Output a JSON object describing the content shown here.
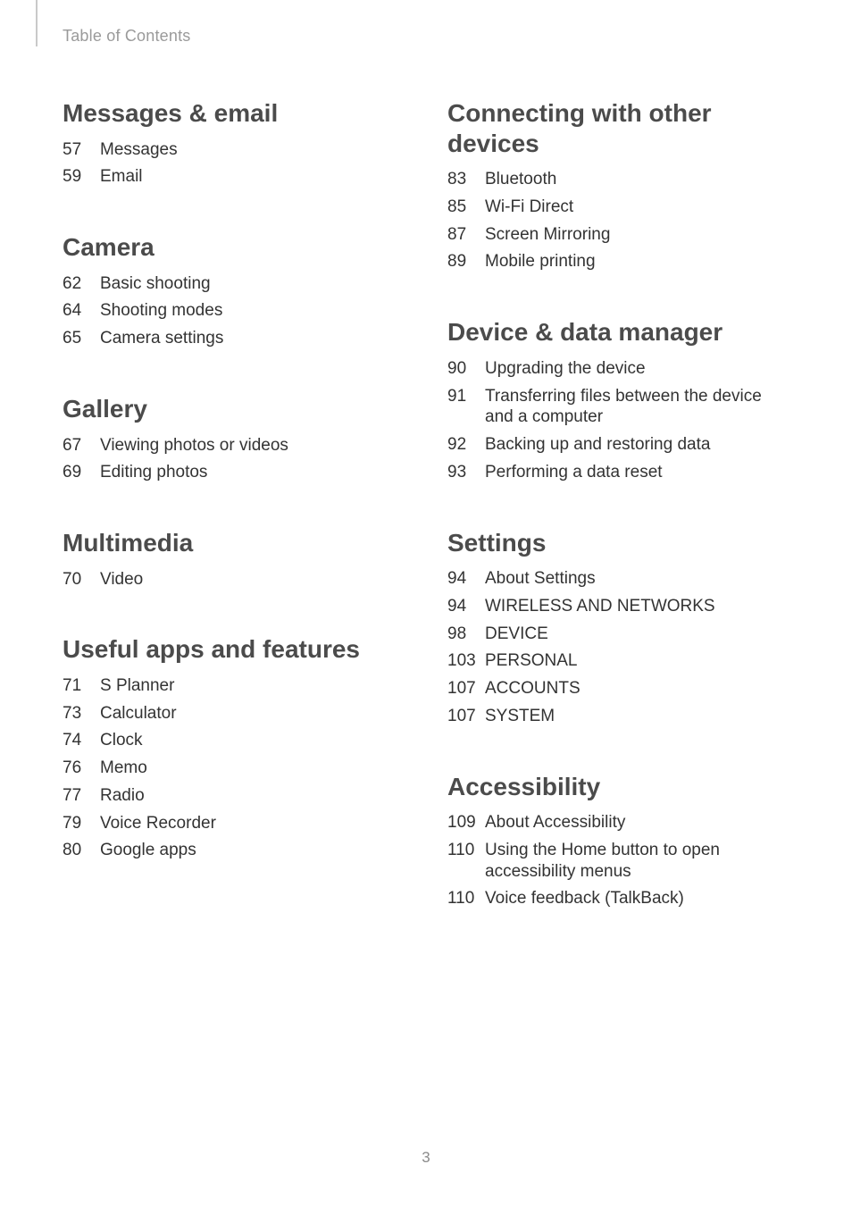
{
  "running_head": "Table of Contents",
  "page_number": "3",
  "left_sections": [
    {
      "title": "Messages & email",
      "entries": [
        {
          "page": "57",
          "title": "Messages"
        },
        {
          "page": "59",
          "title": "Email"
        }
      ]
    },
    {
      "title": "Camera",
      "entries": [
        {
          "page": "62",
          "title": "Basic shooting"
        },
        {
          "page": "64",
          "title": "Shooting modes"
        },
        {
          "page": "65",
          "title": "Camera settings"
        }
      ]
    },
    {
      "title": "Gallery",
      "entries": [
        {
          "page": "67",
          "title": "Viewing photos or videos"
        },
        {
          "page": "69",
          "title": "Editing photos"
        }
      ]
    },
    {
      "title": "Multimedia",
      "entries": [
        {
          "page": "70",
          "title": "Video"
        }
      ]
    },
    {
      "title": "Useful apps and features",
      "entries": [
        {
          "page": "71",
          "title": "S Planner"
        },
        {
          "page": "73",
          "title": "Calculator"
        },
        {
          "page": "74",
          "title": "Clock"
        },
        {
          "page": "76",
          "title": "Memo"
        },
        {
          "page": "77",
          "title": "Radio"
        },
        {
          "page": "79",
          "title": "Voice Recorder"
        },
        {
          "page": "80",
          "title": "Google apps"
        }
      ]
    }
  ],
  "right_sections": [
    {
      "title": "Connecting with other devices",
      "entries": [
        {
          "page": "83",
          "title": "Bluetooth"
        },
        {
          "page": "85",
          "title": "Wi-Fi Direct"
        },
        {
          "page": "87",
          "title": "Screen Mirroring"
        },
        {
          "page": "89",
          "title": "Mobile printing"
        }
      ]
    },
    {
      "title": "Device & data manager",
      "entries": [
        {
          "page": "90",
          "title": "Upgrading the device"
        },
        {
          "page": "91",
          "title": "Transferring files between the device and a computer"
        },
        {
          "page": "92",
          "title": "Backing up and restoring data"
        },
        {
          "page": "93",
          "title": "Performing a data reset"
        }
      ]
    },
    {
      "title": "Settings",
      "entries": [
        {
          "page": "94",
          "title": "About Settings"
        },
        {
          "page": "94",
          "title": "WIRELESS AND NETWORKS"
        },
        {
          "page": "98",
          "title": "DEVICE"
        },
        {
          "page": "103",
          "title": "PERSONAL"
        },
        {
          "page": "107",
          "title": "ACCOUNTS"
        },
        {
          "page": "107",
          "title": "SYSTEM"
        }
      ]
    },
    {
      "title": "Accessibility",
      "entries": [
        {
          "page": "109",
          "title": "About Accessibility"
        },
        {
          "page": "110",
          "title": "Using the Home button to open accessibility menus"
        },
        {
          "page": "110",
          "title": "Voice feedback (TalkBack)"
        }
      ]
    }
  ]
}
